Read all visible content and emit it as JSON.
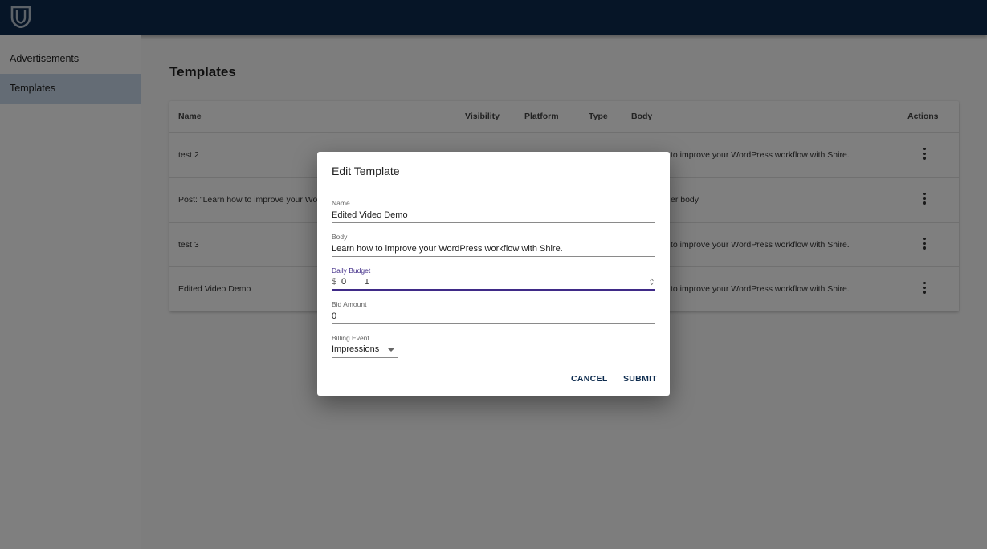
{
  "sidebar": {
    "items": [
      {
        "label": "Advertisements"
      },
      {
        "label": "Templates"
      }
    ]
  },
  "page": {
    "title": "Templates"
  },
  "table": {
    "headers": {
      "name": "Name",
      "visibility": "Visibility",
      "platform": "Platform",
      "type": "Type",
      "body": "Body",
      "actions": "Actions"
    },
    "rows": [
      {
        "name": "test 2",
        "body": "to improve your WordPress workflow with Shire."
      },
      {
        "name": "Post: \"Learn how to improve your Wor",
        "body": "er body"
      },
      {
        "name": "test 3",
        "body": "to improve your WordPress workflow with Shire."
      },
      {
        "name": "Edited Video Demo",
        "body": "to improve your WordPress workflow with Shire."
      }
    ]
  },
  "dialog": {
    "title": "Edit Template",
    "fields": {
      "name": {
        "label": "Name",
        "value": "Edited Video Demo"
      },
      "body": {
        "label": "Body",
        "value": "Learn how to improve your WordPress workflow with Shire."
      },
      "daily_budget": {
        "label": "Daily Budget",
        "value": "0",
        "adornment": "$"
      },
      "bid_amount": {
        "label": "Bid Amount",
        "value": "0"
      },
      "billing_event": {
        "label": "Billing Event",
        "value": "Impressions"
      }
    },
    "cancel_label": "CANCEL",
    "submit_label": "SUBMIT"
  },
  "colors": {
    "appbar": "#0d2b4e",
    "active_nav": "#c9d9eb",
    "focus": "#3f2a87"
  },
  "icons": {
    "logo": "shield-logo-icon",
    "row_actions": "more-vert-icon",
    "select": "arrow-drop-down-icon",
    "spinner": "number-spinner-icon",
    "cursor": "text-cursor-icon"
  }
}
